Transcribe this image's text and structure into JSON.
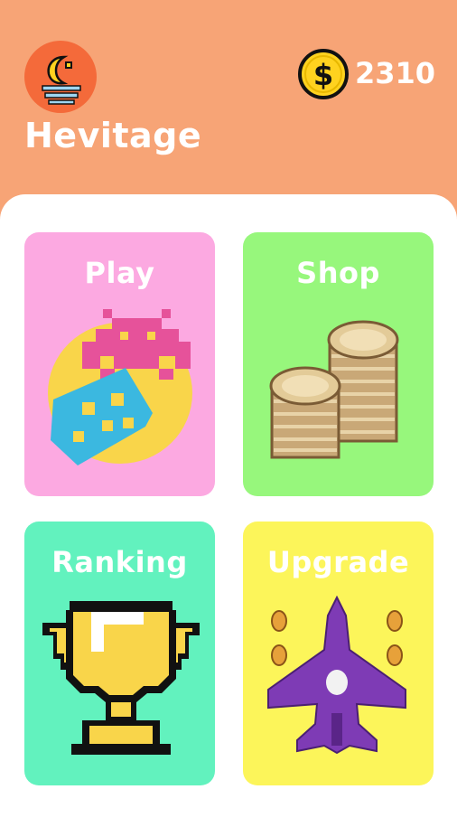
{
  "header": {
    "title": "Hevitage",
    "coins": "2310",
    "avatar_icon": "moon-over-water-icon",
    "coin_icon": "dollar-coin-icon"
  },
  "menu": [
    {
      "label": "Play",
      "icon": "space-invaders-icon",
      "color": "#FCA9E1"
    },
    {
      "label": "Shop",
      "icon": "coin-stacks-icon",
      "color": "#97F77C"
    },
    {
      "label": "Ranking",
      "icon": "trophy-icon",
      "color": "#62F2BE"
    },
    {
      "label": "Upgrade",
      "icon": "fighter-jet-icon",
      "color": "#FCF55A"
    }
  ],
  "colors": {
    "header_bg": "#F7A476",
    "avatar_bg": "#F46A3A",
    "panel_bg": "#FFFFFF"
  }
}
